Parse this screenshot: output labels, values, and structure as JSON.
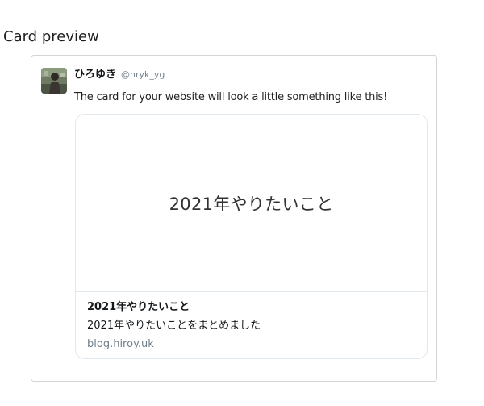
{
  "section": {
    "title": "Card preview"
  },
  "tweet": {
    "avatar_icon": "user-avatar-photo",
    "display_name": "ひろゆき",
    "handle": "@hryk_yg",
    "text": "The card for your website will look a little something like this!"
  },
  "card": {
    "image_text": "2021年やりたいこと",
    "title": "2021年やりたいこと",
    "description": "2021年やりたいことをまとめました",
    "domain": "blog.hiroy.uk"
  },
  "colors": {
    "frame_border": "#d4d4d4",
    "card_border": "#e1e8ed",
    "handle": "#7b8590",
    "domain": "#6f7f8c",
    "text": "#14171a"
  }
}
